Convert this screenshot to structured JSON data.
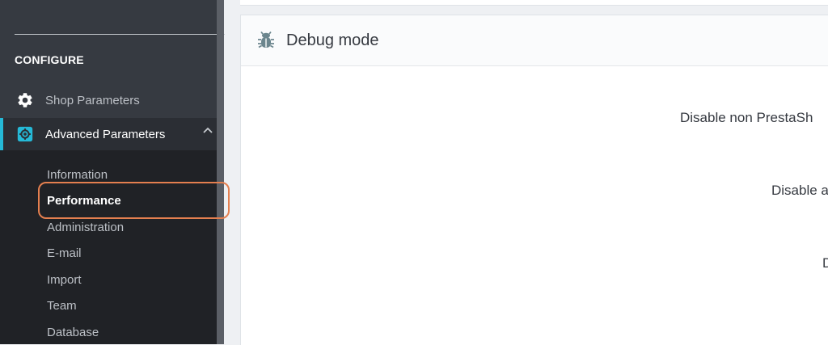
{
  "sidebar": {
    "section_title": "CONFIGURE",
    "items": [
      {
        "label": "Shop Parameters",
        "icon": "gear-icon"
      },
      {
        "label": "Advanced Parameters",
        "icon": "advanced-settings-icon",
        "expanded": true
      }
    ],
    "submenu": [
      {
        "label": "Information"
      },
      {
        "label": "Performance",
        "active": true
      },
      {
        "label": "Administration"
      },
      {
        "label": "E-mail"
      },
      {
        "label": "Import"
      },
      {
        "label": "Team"
      },
      {
        "label": "Database"
      }
    ]
  },
  "main": {
    "panel_title": "Debug mode",
    "panel_icon": "bug-icon",
    "form_labels": [
      "Disable non PrestaSh",
      "Disable a",
      "D"
    ]
  },
  "colors": {
    "sidebar_bg": "#363a41",
    "submenu_bg": "#202226",
    "accent": "#25b9d7",
    "highlight": "#e47f4f"
  }
}
